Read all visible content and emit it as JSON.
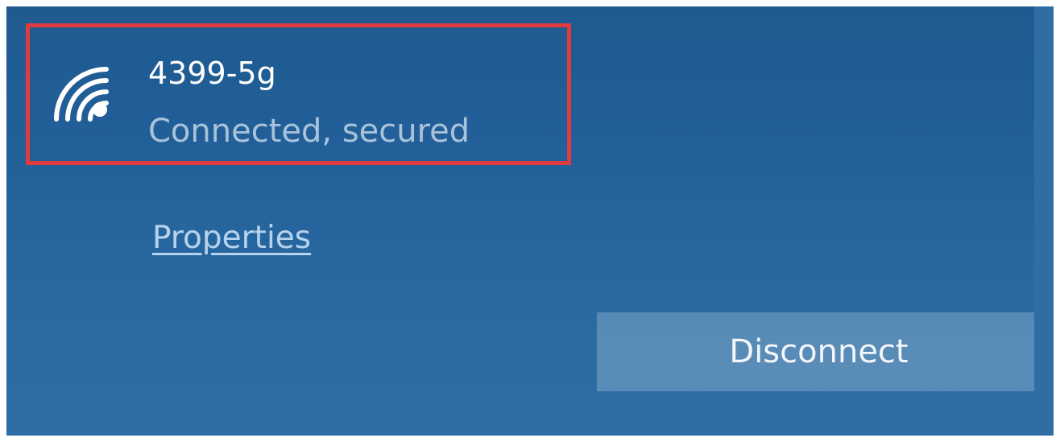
{
  "network": {
    "name": "4399-5g",
    "status": "Connected, secured",
    "icon": "wifi-icon"
  },
  "actions": {
    "properties_label": "Properties",
    "disconnect_label": "Disconnect"
  },
  "colors": {
    "panel_background": "#22609a",
    "highlight_border": "#e23b3b",
    "status_text": "#a9c3da",
    "link_text": "#b6d3ee"
  }
}
